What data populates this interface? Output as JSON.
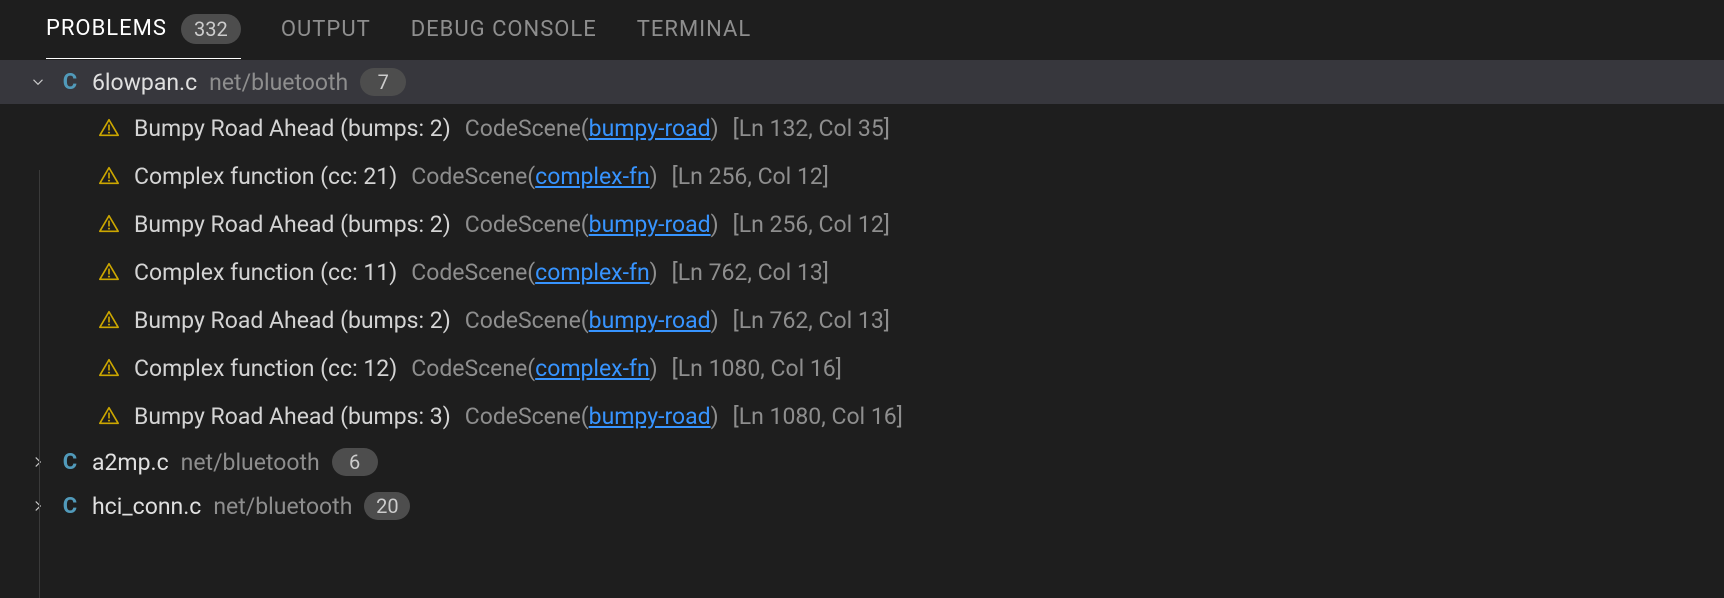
{
  "tabs": {
    "problems": {
      "label": "PROBLEMS",
      "count": "332"
    },
    "output": {
      "label": "OUTPUT"
    },
    "debug_console": {
      "label": "DEBUG CONSOLE"
    },
    "terminal": {
      "label": "TERMINAL"
    }
  },
  "files": [
    {
      "name": "6lowpan.c",
      "folder": "net/bluetooth",
      "count": "7",
      "expanded": true,
      "selected": true,
      "problems": [
        {
          "message": "Bumpy Road Ahead (bumps: 2)",
          "source": "CodeScene",
          "link": "bumpy-road",
          "line": "132",
          "col": "35"
        },
        {
          "message": "Complex function (cc: 21)",
          "source": "CodeScene",
          "link": "complex-fn",
          "line": "256",
          "col": "12"
        },
        {
          "message": "Bumpy Road Ahead (bumps: 2)",
          "source": "CodeScene",
          "link": "bumpy-road",
          "line": "256",
          "col": "12"
        },
        {
          "message": "Complex function (cc: 11)",
          "source": "CodeScene",
          "link": "complex-fn",
          "line": "762",
          "col": "13"
        },
        {
          "message": "Bumpy Road Ahead (bumps: 2)",
          "source": "CodeScene",
          "link": "bumpy-road",
          "line": "762",
          "col": "13"
        },
        {
          "message": "Complex function (cc: 12)",
          "source": "CodeScene",
          "link": "complex-fn",
          "line": "1080",
          "col": "16"
        },
        {
          "message": "Bumpy Road Ahead (bumps: 3)",
          "source": "CodeScene",
          "link": "bumpy-road",
          "line": "1080",
          "col": "16"
        }
      ]
    },
    {
      "name": "a2mp.c",
      "folder": "net/bluetooth",
      "count": "6",
      "expanded": false,
      "selected": false,
      "problems": []
    },
    {
      "name": "hci_conn.c",
      "folder": "net/bluetooth",
      "count": "20",
      "expanded": false,
      "selected": false,
      "problems": []
    }
  ],
  "strings": {
    "loc_prefix": "[Ln ",
    "loc_mid": ", Col ",
    "loc_suffix": "]"
  },
  "colors": {
    "link": "#3794ff",
    "warn": "#cca700",
    "file_icon": "#519aba"
  }
}
